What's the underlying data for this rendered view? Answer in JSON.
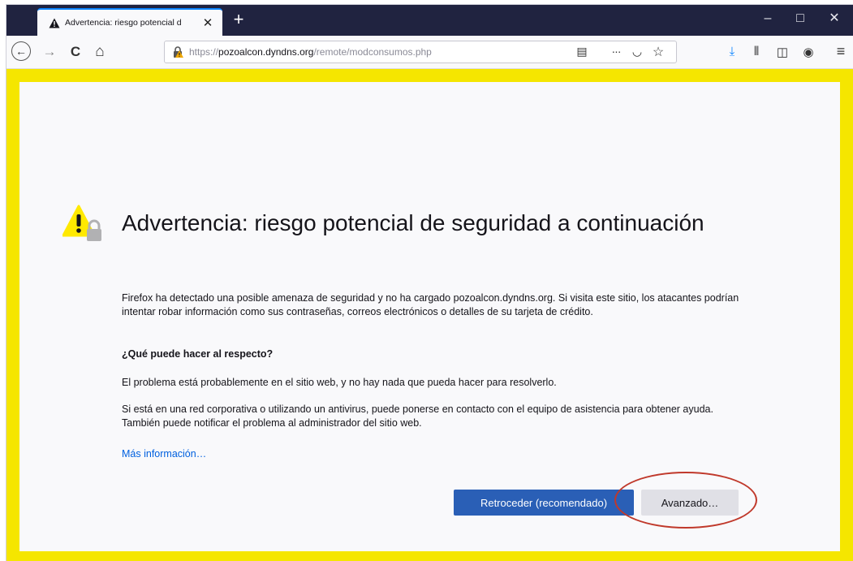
{
  "tab": {
    "title": "Advertencia: riesgo potencial d",
    "close": "✕"
  },
  "new_tab": "+",
  "window_controls": {
    "minimize": "–",
    "maximize": "□",
    "close": "✕"
  },
  "nav": {
    "back": "←",
    "forward": "→",
    "reload": "C",
    "home": "⌂"
  },
  "url": {
    "scheme": "https://",
    "host": "pozoalcon.dyndns.org",
    "path": "/remote/modconsumos.php"
  },
  "url_actions": {
    "reader": "▤",
    "more": "···",
    "pocket": "◡",
    "bookmark": "☆"
  },
  "toolbar": {
    "download": "⤓",
    "library": "⫴",
    "sidebar": "◫",
    "account": "◉",
    "menu": "≡"
  },
  "page": {
    "title": "Advertencia: riesgo potencial de seguridad a continuación",
    "intro": "Firefox ha detectado una posible amenaza de seguridad y no ha cargado pozoalcon.dyndns.org. Si visita este sitio, los atacantes podrían intentar robar información como sus contraseñas, correos electrónicos o detalles de su tarjeta de crédito.",
    "subheading": "¿Qué puede hacer al respecto?",
    "para1": "El problema está probablemente en el sitio web, y no hay nada que pueda hacer para resolverlo.",
    "para2": "Si está en una red corporativa o utilizando un antivirus, puede ponerse en contacto con el equipo de asistencia para obtener ayuda. También puede notificar el problema al administrador del sitio web.",
    "more_info": "Más información…",
    "back_button": "Retroceder (recomendado)",
    "advanced_button": "Avanzado…"
  },
  "colors": {
    "accent_blue": "#2a5fb6",
    "highlight_frame": "#f5e600",
    "annotation_ring": "#c0392b",
    "tabbar": "#202340"
  }
}
